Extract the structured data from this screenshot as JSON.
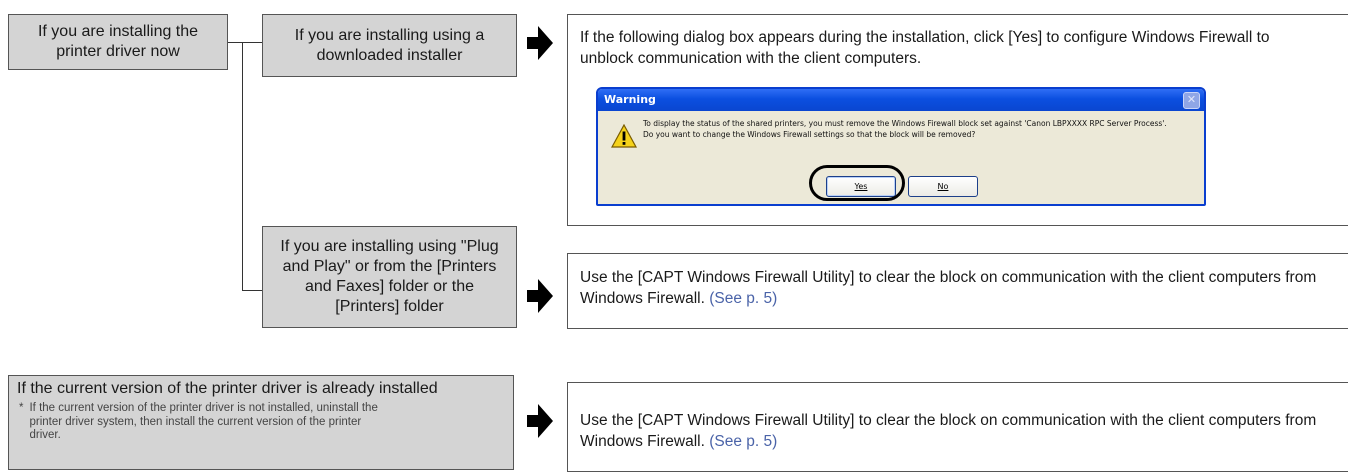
{
  "flow": {
    "box_now": "If you are installing the printer driver now",
    "box_downloaded": "If you are installing using a downloaded installer",
    "box_plug": "If you are installing using \"Plug and Play\" or from the [Printers and Faxes] folder or the [Printers] folder",
    "box_current": "If the current version of the printer driver is already installed",
    "box_current_note_mark": "*",
    "box_current_note": "If the current version of the printer driver is not installed, uninstall the printer driver system, then install the current version of the printer driver."
  },
  "panels": {
    "top_text": "If the following dialog box appears during the installation, click [Yes] to configure Windows Firewall to unblock communication with the client computers.",
    "mid_text": "Use the [CAPT Windows Firewall Utility] to clear the block on communication with the client computers from Windows Firewall.",
    "mid_link": "(See p. 5)",
    "bottom_text": "Use the [CAPT Windows Firewall Utility] to clear the block on communication with the client computers from Windows Firewall.",
    "bottom_link": "(See p. 5)"
  },
  "dialog": {
    "title": "Warning",
    "close_glyph": "✕",
    "line1": "To display the status of the shared printers, you must remove the Windows Firewall block set against 'Canon LBPXXXX RPC Server Process'.",
    "line2": "Do you want to change the Windows Firewall settings so that the block will be removed?",
    "yes_label": "Yes",
    "no_label": "No",
    "icon": "warning-icon"
  },
  "colors": {
    "box_fill": "#d4d4d4",
    "link": "#4a63a8",
    "titlebar": "#0b4fe0"
  }
}
